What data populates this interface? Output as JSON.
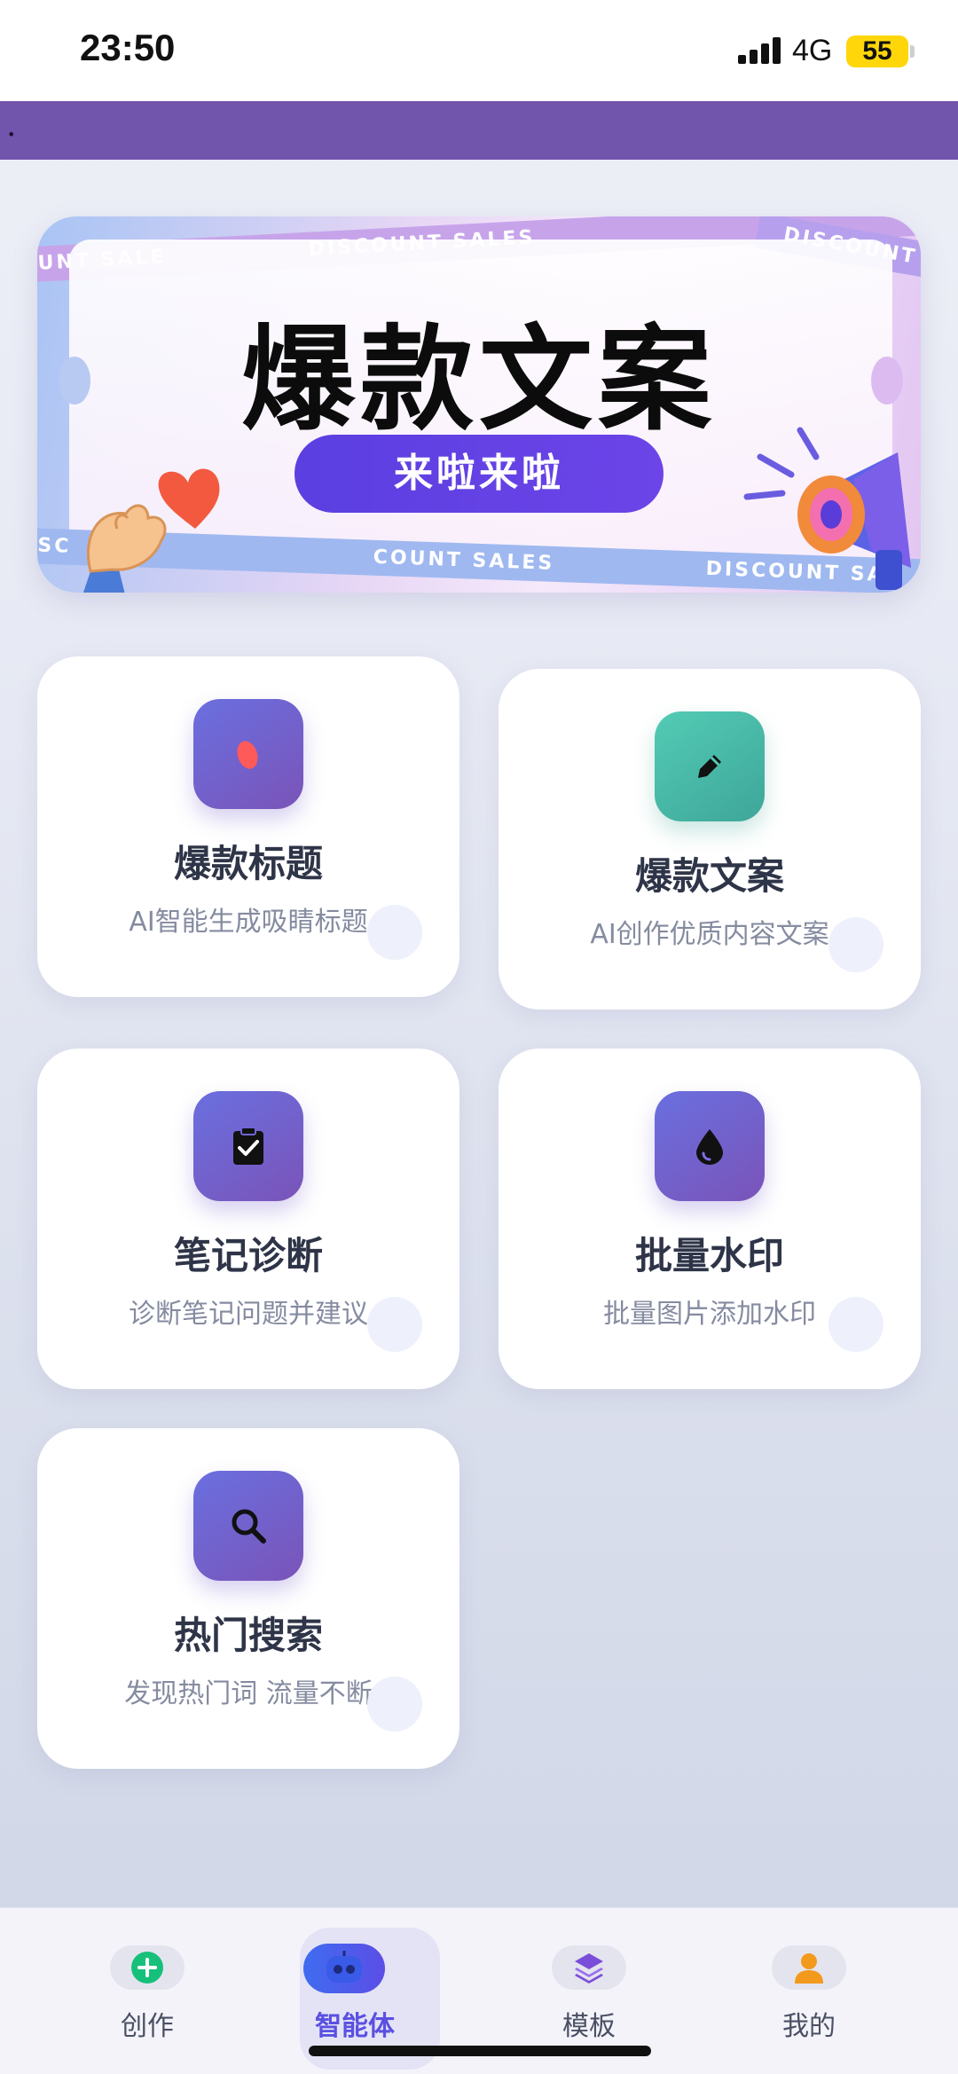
{
  "status_bar": {
    "time": "23:50",
    "network": "4G",
    "battery": "55"
  },
  "banner": {
    "title": "爆款文案",
    "button": "来啦来啦",
    "ribbon_text": "DISCOUNT SALES",
    "ribbon_text_cut1": "UNT SALE",
    "ribbon_text_cut2": "DISCOUNT SA",
    "ribbon_text_cut3": "SC",
    "ribbon_text_cut4": "COUNT SALES"
  },
  "cards": [
    {
      "title": "爆款标题",
      "subtitle": "AI智能生成吸睛标题",
      "icon": "flame-icon"
    },
    {
      "title": "爆款文案",
      "subtitle": "AI创作优质内容文案",
      "icon": "pen-icon"
    },
    {
      "title": "笔记诊断",
      "subtitle": "诊断笔记问题并建议",
      "icon": "clipboard-check-icon"
    },
    {
      "title": "批量水印",
      "subtitle": "批量图片添加水印",
      "icon": "drop-icon"
    },
    {
      "title": "热门搜索",
      "subtitle": "发现热门词 流量不断",
      "icon": "search-icon"
    }
  ],
  "tabbar": {
    "items": [
      {
        "label": "创作",
        "icon": "plus-circle-icon"
      },
      {
        "label": "智能体",
        "icon": "robot-icon"
      },
      {
        "label": "模板",
        "icon": "layers-icon"
      },
      {
        "label": "我的",
        "icon": "user-icon"
      }
    ],
    "active_index": 1
  },
  "colors": {
    "accent_purple": "#7154ac",
    "primary_blue": "#5a50e0",
    "card_icon_gradient": "#6a6fe0",
    "teal": "#53cbb4",
    "create_green": "#17c07a",
    "user_orange": "#f39a1d"
  }
}
